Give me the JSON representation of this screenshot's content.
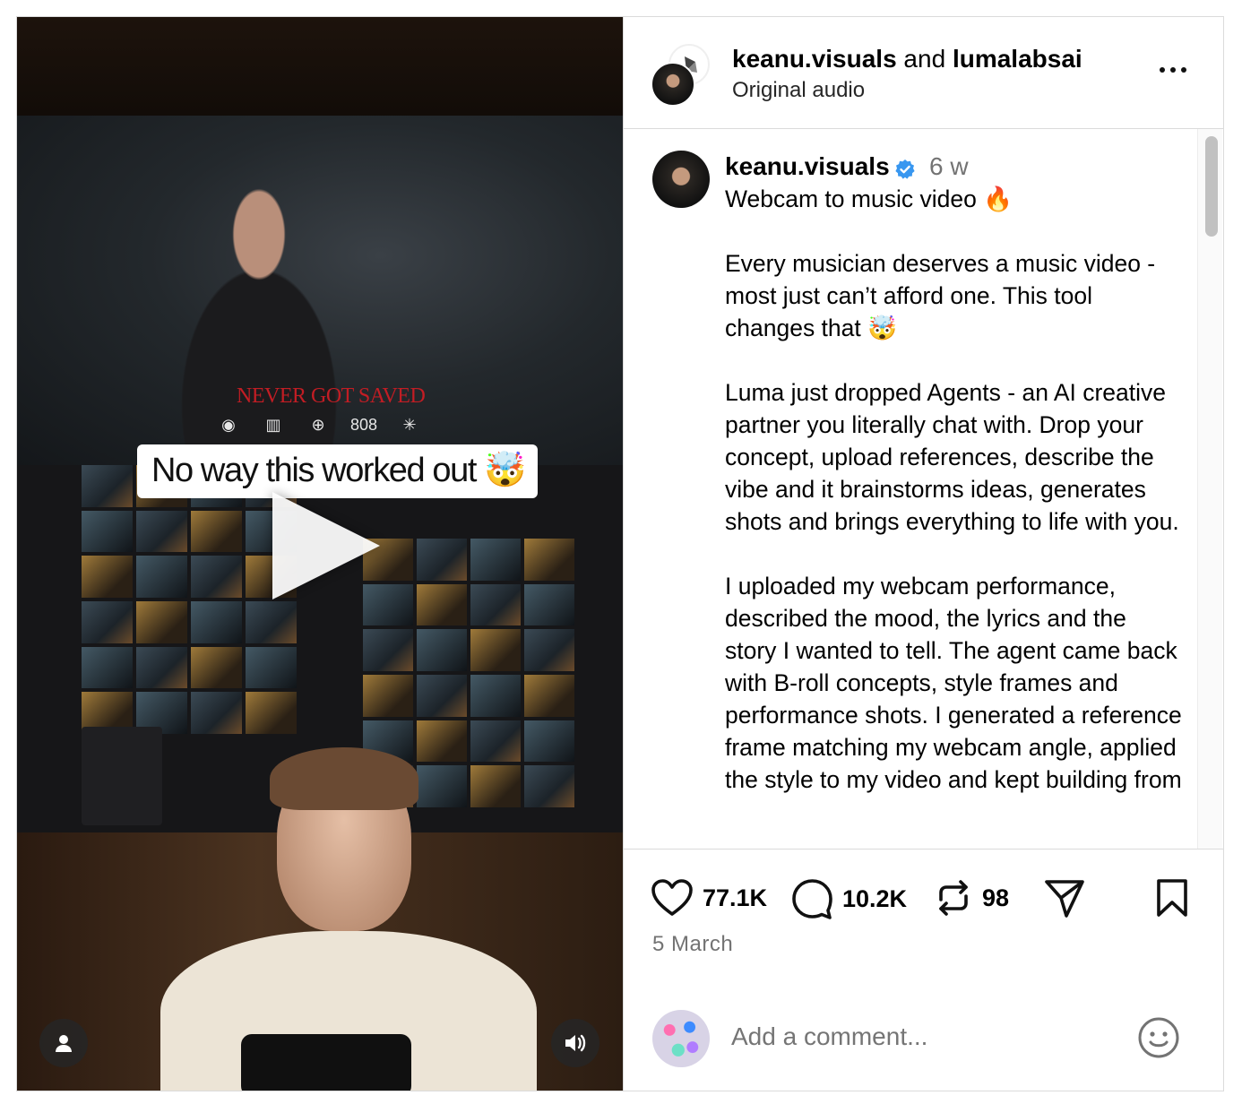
{
  "post": {
    "caption_overlay": "No way this worked out 🤯",
    "media_brand_text": "NEVER GOT SAVED",
    "media_badges": [
      "◉",
      "▥",
      "⊕",
      "808",
      "✳"
    ],
    "colors": {
      "verified": "#3897f0",
      "secondary_text": "#737373",
      "border": "#dbdbdb"
    }
  },
  "header": {
    "user1": "keanu.visuals",
    "connector": " and ",
    "user2": "lumalabsai",
    "audio": "Original audio"
  },
  "caption": {
    "username": "keanu.visuals",
    "time": "6 w",
    "text": "Webcam to music video 🔥\n\nEvery musician deserves a music video - most just can’t afford one. This tool changes that 🤯\n\nLuma just dropped Agents - an AI creative partner you literally chat with. Drop your concept, upload references, describe the vibe and it brainstorms ideas, generates shots and brings everything to life with you.\n\nI uploaded my webcam performance, described the mood, the lyrics and the story I wanted to tell. The agent came back with B-roll concepts, style frames and performance shots. I generated a reference frame matching my webcam angle, applied the style to my video and kept building from"
  },
  "actions": {
    "likes": "77.1K",
    "comments": "10.2K",
    "reposts": "98",
    "date": "5 March",
    "icons": [
      "heart-icon",
      "comment-icon",
      "repost-icon",
      "share-icon",
      "bookmark-icon"
    ]
  },
  "comment_box": {
    "placeholder": "Add a comment..."
  }
}
